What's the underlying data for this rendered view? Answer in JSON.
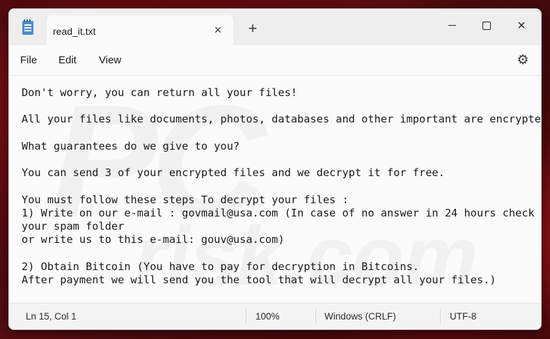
{
  "window": {
    "tab_title": "read_it.txt",
    "tab_close_icon": "×",
    "new_tab_icon": "+",
    "minimize_icon": "minimize-icon",
    "maximize_icon": "maximize-icon",
    "close_icon": "×"
  },
  "menu": {
    "file": "File",
    "edit": "Edit",
    "view": "View",
    "settings_icon": "⚙"
  },
  "document": {
    "lines": [
      "Don't worry, you can return all your files!",
      "",
      "All your files like documents, photos, databases and other important are encrypted",
      "",
      "What guarantees do we give to you?",
      "",
      "You can send 3 of your encrypted files and we decrypt it for free.",
      "",
      "You must follow these steps To decrypt your files :",
      "1) Write on our e-mail : govmail@usa.com (In case of no answer in 24 hours check",
      "your spam folder",
      "or write us to this e-mail: gouv@usa.com)",
      "",
      "2) Obtain Bitcoin (You have to pay for decryption in Bitcoins.",
      "After payment we will send you the tool that will decrypt all your files.)"
    ],
    "watermark": "PC",
    "watermark2": "risk.com"
  },
  "status": {
    "position": "Ln 15, Col 1",
    "zoom": "100%",
    "line_ending": "Windows (CRLF)",
    "encoding": "UTF-8"
  }
}
